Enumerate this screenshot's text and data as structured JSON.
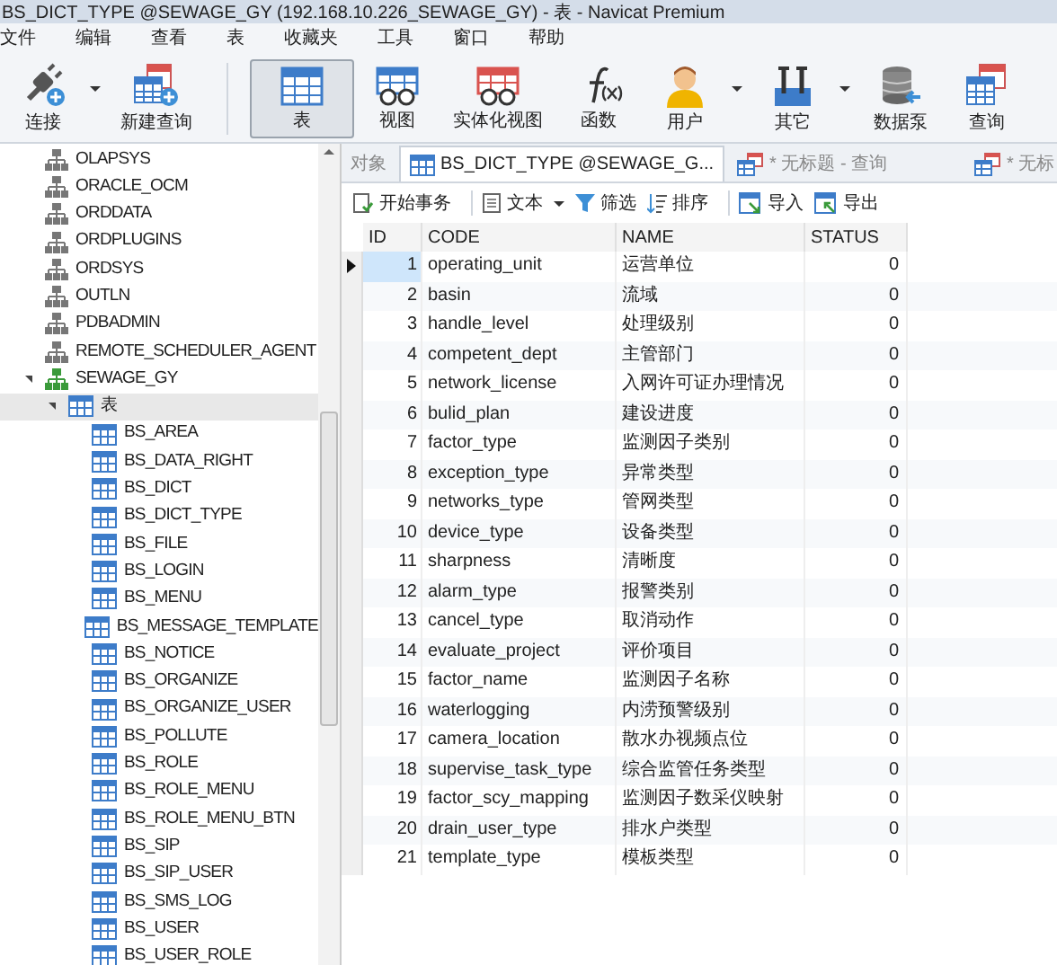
{
  "window": {
    "title": "BS_DICT_TYPE @SEWAGE_GY (192.168.10.226_SEWAGE_GY) - 表 - Navicat Premium"
  },
  "menu": [
    "文件",
    "编辑",
    "查看",
    "表",
    "收藏夹",
    "工具",
    "窗口",
    "帮助"
  ],
  "toolbar": [
    {
      "label": "连接",
      "kind": "connect",
      "selected": false,
      "dropdown": true
    },
    {
      "label": "新建查询",
      "kind": "newquery",
      "selected": false,
      "dropdown": false
    },
    {
      "label": "表",
      "kind": "table",
      "selected": true,
      "dropdown": false
    },
    {
      "label": "视图",
      "kind": "view",
      "selected": false,
      "dropdown": false
    },
    {
      "label": "实体化视图",
      "kind": "matview",
      "selected": false,
      "dropdown": false
    },
    {
      "label": "函数",
      "kind": "function",
      "selected": false,
      "dropdown": false
    },
    {
      "label": "用户",
      "kind": "user",
      "selected": false,
      "dropdown": true
    },
    {
      "label": "其它",
      "kind": "other",
      "selected": false,
      "dropdown": true
    },
    {
      "label": "数据泵",
      "kind": "datapump",
      "selected": false,
      "dropdown": false
    },
    {
      "label": "查询",
      "kind": "query",
      "selected": false,
      "dropdown": false
    }
  ],
  "tree": [
    {
      "label": "OLAPSYS",
      "kind": "schema",
      "selected": false
    },
    {
      "label": "ORACLE_OCM",
      "kind": "schema",
      "selected": false
    },
    {
      "label": "ORDDATA",
      "kind": "schema",
      "selected": false
    },
    {
      "label": "ORDPLUGINS",
      "kind": "schema",
      "selected": false
    },
    {
      "label": "ORDSYS",
      "kind": "schema",
      "selected": false
    },
    {
      "label": "OUTLN",
      "kind": "schema",
      "selected": false
    },
    {
      "label": "PDBADMIN",
      "kind": "schema",
      "selected": false
    },
    {
      "label": "REMOTE_SCHEDULER_AGENT",
      "kind": "schema",
      "selected": false
    },
    {
      "label": "SEWAGE_GY",
      "kind": "schema_open",
      "selected": false,
      "expanded": true,
      "children": [
        {
          "label": "表",
          "kind": "folder",
          "selected": true,
          "expanded": true,
          "children": [
            {
              "label": "BS_AREA",
              "kind": "table",
              "selected": false
            },
            {
              "label": "BS_DATA_RIGHT",
              "kind": "table",
              "selected": false
            },
            {
              "label": "BS_DICT",
              "kind": "table",
              "selected": false
            },
            {
              "label": "BS_DICT_TYPE",
              "kind": "table",
              "selected": false
            },
            {
              "label": "BS_FILE",
              "kind": "table",
              "selected": false
            },
            {
              "label": "BS_LOGIN",
              "kind": "table",
              "selected": false
            },
            {
              "label": "BS_MENU",
              "kind": "table",
              "selected": false
            },
            {
              "label": "BS_MESSAGE_TEMPLATE",
              "kind": "table",
              "selected": false
            },
            {
              "label": "BS_NOTICE",
              "kind": "table",
              "selected": false
            },
            {
              "label": "BS_ORGANIZE",
              "kind": "table",
              "selected": false
            },
            {
              "label": "BS_ORGANIZE_USER",
              "kind": "table",
              "selected": false
            },
            {
              "label": "BS_POLLUTE",
              "kind": "table",
              "selected": false
            },
            {
              "label": "BS_ROLE",
              "kind": "table",
              "selected": false
            },
            {
              "label": "BS_ROLE_MENU",
              "kind": "table",
              "selected": false
            },
            {
              "label": "BS_ROLE_MENU_BTN",
              "kind": "table",
              "selected": false
            },
            {
              "label": "BS_SIP",
              "kind": "table",
              "selected": false
            },
            {
              "label": "BS_SIP_USER",
              "kind": "table",
              "selected": false
            },
            {
              "label": "BS_SMS_LOG",
              "kind": "table",
              "selected": false
            },
            {
              "label": "BS_USER",
              "kind": "table",
              "selected": false
            },
            {
              "label": "BS_USER_ROLE",
              "kind": "table",
              "selected": false
            }
          ]
        }
      ]
    }
  ],
  "tabs": [
    {
      "label": "对象",
      "kind": "objects",
      "selected": false
    },
    {
      "label": "BS_DICT_TYPE @SEWAGE_G...",
      "kind": "table",
      "selected": true
    },
    {
      "label": "* 无标题 - 查询",
      "kind": "query",
      "selected": false
    },
    {
      "label": "* 无标",
      "kind": "query",
      "selected": false
    }
  ],
  "grid_toolbar": [
    {
      "label": "开始事务",
      "kind": "transaction",
      "dropdown": false
    },
    {
      "label": "文本",
      "kind": "text",
      "dropdown": true
    },
    {
      "label": "筛选",
      "kind": "filter",
      "dropdown": false
    },
    {
      "label": "排序",
      "kind": "sort",
      "dropdown": false
    },
    {
      "label": "导入",
      "kind": "import",
      "dropdown": false
    },
    {
      "label": "导出",
      "kind": "export",
      "dropdown": false
    }
  ],
  "table": {
    "columns": [
      "ID",
      "CODE",
      "NAME",
      "STATUS"
    ],
    "rows": [
      {
        "cells": [
          "1",
          "operating_unit",
          "运营单位",
          "0"
        ],
        "selected": true
      },
      {
        "cells": [
          "2",
          "basin",
          "流域",
          "0"
        ],
        "selected": false
      },
      {
        "cells": [
          "3",
          "handle_level",
          "处理级别",
          "0"
        ],
        "selected": false
      },
      {
        "cells": [
          "4",
          "competent_dept",
          "主管部门",
          "0"
        ],
        "selected": false
      },
      {
        "cells": [
          "5",
          "network_license",
          "入网许可证办理情况",
          "0"
        ],
        "selected": false
      },
      {
        "cells": [
          "6",
          "bulid_plan",
          "建设进度",
          "0"
        ],
        "selected": false
      },
      {
        "cells": [
          "7",
          "factor_type",
          "监测因子类别",
          "0"
        ],
        "selected": false
      },
      {
        "cells": [
          "8",
          "exception_type",
          "异常类型",
          "0"
        ],
        "selected": false
      },
      {
        "cells": [
          "9",
          "networks_type",
          "管网类型",
          "0"
        ],
        "selected": false
      },
      {
        "cells": [
          "10",
          "device_type",
          "设备类型",
          "0"
        ],
        "selected": false
      },
      {
        "cells": [
          "11",
          "sharpness",
          "清晰度",
          "0"
        ],
        "selected": false
      },
      {
        "cells": [
          "12",
          "alarm_type",
          "报警类别",
          "0"
        ],
        "selected": false
      },
      {
        "cells": [
          "13",
          "cancel_type",
          "取消动作",
          "0"
        ],
        "selected": false
      },
      {
        "cells": [
          "14",
          "evaluate_project",
          "评价项目",
          "0"
        ],
        "selected": false
      },
      {
        "cells": [
          "15",
          "factor_name",
          "监测因子名称",
          "0"
        ],
        "selected": false
      },
      {
        "cells": [
          "16",
          "waterlogging",
          "内涝预警级别",
          "0"
        ],
        "selected": false
      },
      {
        "cells": [
          "17",
          "camera_location",
          "散水办视频点位",
          "0"
        ],
        "selected": false
      },
      {
        "cells": [
          "18",
          "supervise_task_type",
          "综合监管任务类型",
          "0"
        ],
        "selected": false
      },
      {
        "cells": [
          "19",
          "factor_scy_mapping",
          "监测因子数采仪映射",
          "0"
        ],
        "selected": false
      },
      {
        "cells": [
          "20",
          "drain_user_type",
          "排水户类型",
          "0"
        ],
        "selected": false
      },
      {
        "cells": [
          "21",
          "template_type",
          "模板类型",
          "0"
        ],
        "selected": false
      }
    ]
  }
}
